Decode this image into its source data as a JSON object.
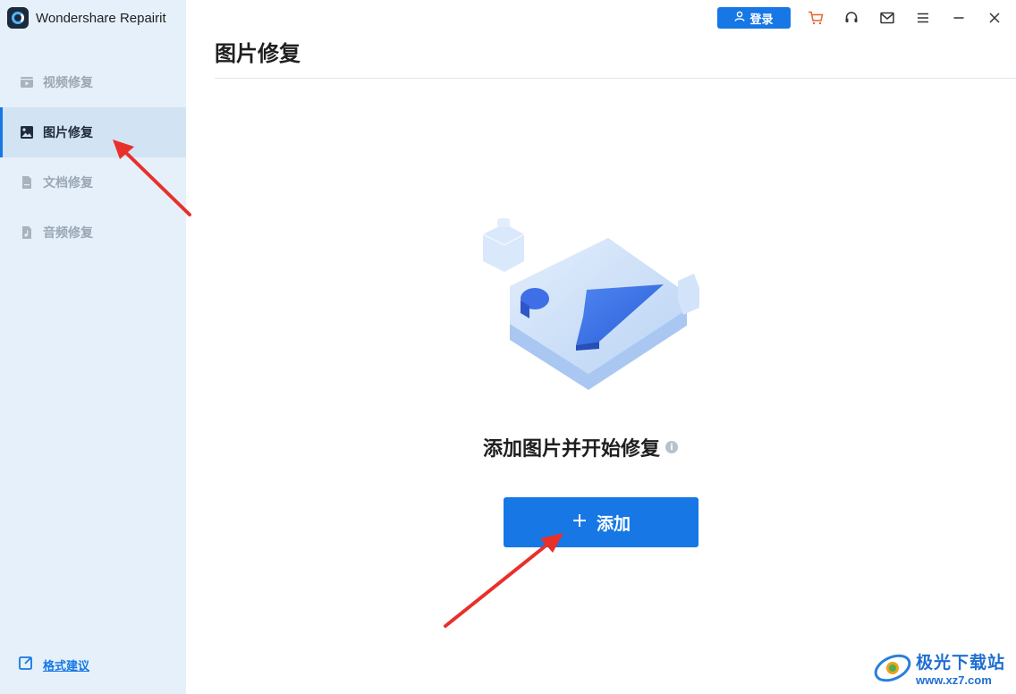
{
  "app": {
    "title": "Wondershare Repairit"
  },
  "sidebar": {
    "items": [
      {
        "label": "视频修复",
        "icon": "video-icon",
        "active": false
      },
      {
        "label": "图片修复",
        "icon": "image-icon",
        "active": true
      },
      {
        "label": "文档修复",
        "icon": "document-icon",
        "active": false
      },
      {
        "label": "音频修复",
        "icon": "audio-icon",
        "active": false
      }
    ],
    "feedback_label": "格式建议"
  },
  "topbar": {
    "login_label": "登录",
    "icons": [
      "cart-icon",
      "headset-icon",
      "mail-icon",
      "menu-icon",
      "minimize-icon",
      "close-icon"
    ]
  },
  "main": {
    "title": "图片修复",
    "prompt": "添加图片并开始修复",
    "add_label": "添加"
  },
  "watermark": {
    "title": "极光下载站",
    "url": "www.xz7.com"
  },
  "colors": {
    "accent": "#1677e5",
    "sidebar_bg": "#e6f0fa",
    "annotation": "#e8302a"
  }
}
